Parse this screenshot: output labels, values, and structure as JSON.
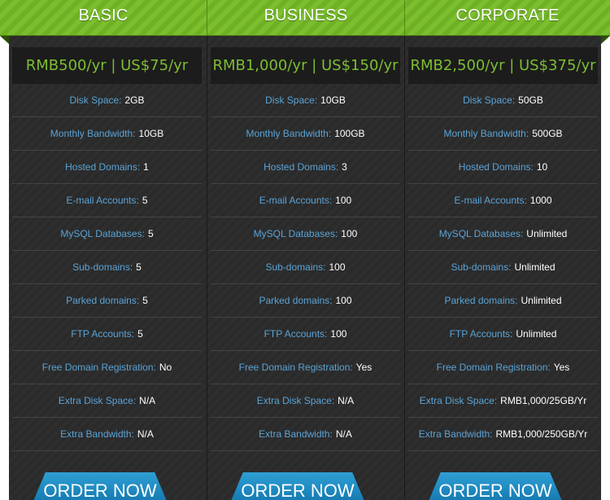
{
  "plans": [
    {
      "name": "BASIC",
      "price": "RMB500/yr | US$75/yr",
      "features": [
        {
          "label": "Disk Space:",
          "value": "2GB"
        },
        {
          "label": "Monthly Bandwidth:",
          "value": "10GB"
        },
        {
          "label": "Hosted Domains:",
          "value": "1"
        },
        {
          "label": "E-mail Accounts:",
          "value": "5"
        },
        {
          "label": "MySQL Databases:",
          "value": "5"
        },
        {
          "label": "Sub-domains:",
          "value": "5"
        },
        {
          "label": "Parked domains:",
          "value": "5"
        },
        {
          "label": "FTP Accounts:",
          "value": "5"
        },
        {
          "label": "Free Domain Registration:",
          "value": "No"
        },
        {
          "label": "Extra Disk Space:",
          "value": "N/A"
        },
        {
          "label": "Extra Bandwidth:",
          "value": "N/A"
        }
      ],
      "order_label": "ORDER NOW"
    },
    {
      "name": "BUSINESS",
      "price": "RMB1,000/yr | US$150/yr",
      "features": [
        {
          "label": "Disk Space:",
          "value": "10GB"
        },
        {
          "label": "Monthly Bandwidth:",
          "value": "100GB"
        },
        {
          "label": "Hosted Domains:",
          "value": "3"
        },
        {
          "label": "E-mail Accounts:",
          "value": "100"
        },
        {
          "label": "MySQL Databases:",
          "value": "100"
        },
        {
          "label": "Sub-domains:",
          "value": "100"
        },
        {
          "label": "Parked domains:",
          "value": "100"
        },
        {
          "label": "FTP Accounts:",
          "value": "100"
        },
        {
          "label": "Free Domain Registration:",
          "value": "Yes"
        },
        {
          "label": "Extra Disk Space:",
          "value": "N/A"
        },
        {
          "label": "Extra Bandwidth:",
          "value": "N/A"
        }
      ],
      "order_label": "ORDER NOW"
    },
    {
      "name": "CORPORATE",
      "price": "RMB2,500/yr | US$375/yr",
      "features": [
        {
          "label": "Disk Space:",
          "value": "50GB"
        },
        {
          "label": "Monthly Bandwidth:",
          "value": "500GB"
        },
        {
          "label": "Hosted Domains:",
          "value": "10"
        },
        {
          "label": "E-mail Accounts:",
          "value": "1000"
        },
        {
          "label": "MySQL Databases:",
          "value": "Unlimited"
        },
        {
          "label": "Sub-domains:",
          "value": "Unlimited"
        },
        {
          "label": "Parked domains:",
          "value": "Unlimited"
        },
        {
          "label": "FTP Accounts:",
          "value": "Unlimited"
        },
        {
          "label": "Free Domain Registration:",
          "value": "Yes"
        },
        {
          "label": "Extra Disk Space:",
          "value": "RMB1,000/25GB/Yr"
        },
        {
          "label": "Extra Bandwidth:",
          "value": "RMB1,000/250GB/Yr"
        }
      ],
      "order_label": "ORDER NOW"
    }
  ],
  "colors": {
    "header_green": "#7cbf2e",
    "price_green": "#7dbd33",
    "label_blue": "#5aa3d6",
    "button_blue": "#1f8ac2",
    "body_dark": "#2e2e2e"
  }
}
